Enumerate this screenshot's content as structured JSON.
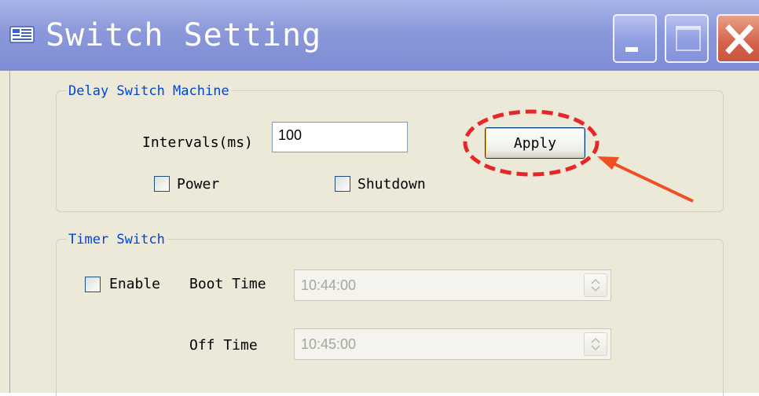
{
  "window": {
    "title": "Switch Setting",
    "controls": [
      "minimize-button",
      "maximize-button",
      "close-button"
    ]
  },
  "delay_group": {
    "legend": "Delay Switch Machine",
    "intervals_label": "Intervals(ms)",
    "intervals_value": "100",
    "apply_label": "Apply",
    "power_label": "Power",
    "power_checked": false,
    "shutdown_label": "Shutdown",
    "shutdown_checked": false
  },
  "timer_group": {
    "legend": "Timer Switch",
    "enable_label": "Enable",
    "enable_checked": false,
    "boot_time_label": "Boot Time",
    "boot_time_value": "10:44:00",
    "off_time_label": "Off Time",
    "off_time_value": "10:45:00"
  },
  "annotation": {
    "color": "#e8262a",
    "arrow_color": "#f04e23",
    "highlights": "apply-button"
  },
  "colors": {
    "titlebar": "#8b98da",
    "legend_text": "#0046d5",
    "dialog_bg": "#ece9d8"
  }
}
